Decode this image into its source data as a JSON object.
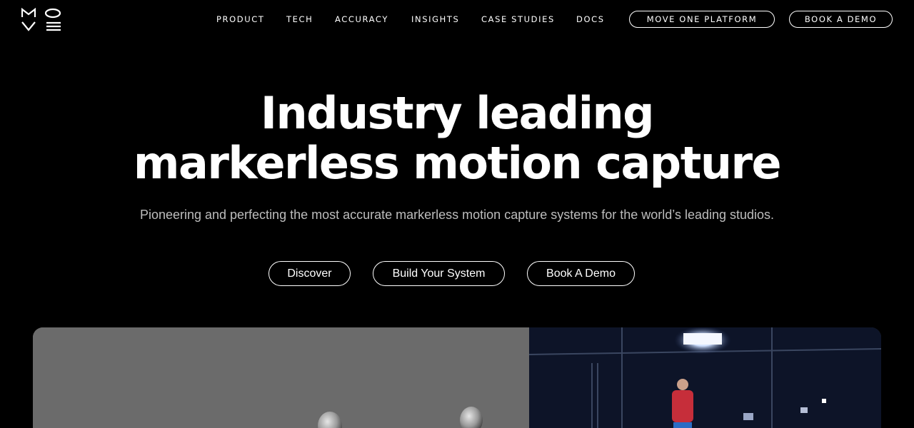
{
  "brand": {
    "logo_text": "MOVE"
  },
  "nav": {
    "items": [
      {
        "label": "PRODUCT"
      },
      {
        "label": "TECH"
      },
      {
        "label": "ACCURACY"
      },
      {
        "label": "INSIGHTS"
      },
      {
        "label": "CASE STUDIES"
      },
      {
        "label": "DOCS"
      }
    ],
    "platform_button": "MOVE ONE PLATFORM",
    "demo_button": "BOOK A DEMO"
  },
  "hero": {
    "title_line1": "Industry leading",
    "title_line2": "markerless motion capture",
    "subtitle": "Pioneering and perfecting the most accurate markerless motion capture systems for the world’s leading studios.",
    "cta_discover": "Discover",
    "cta_build": "Build Your System",
    "cta_demo": "Book A Demo"
  },
  "colors": {
    "background": "#000000",
    "text": "#ffffff",
    "subtitle": "#bdbdbd",
    "media_left_bg": "#6b6b6b"
  }
}
